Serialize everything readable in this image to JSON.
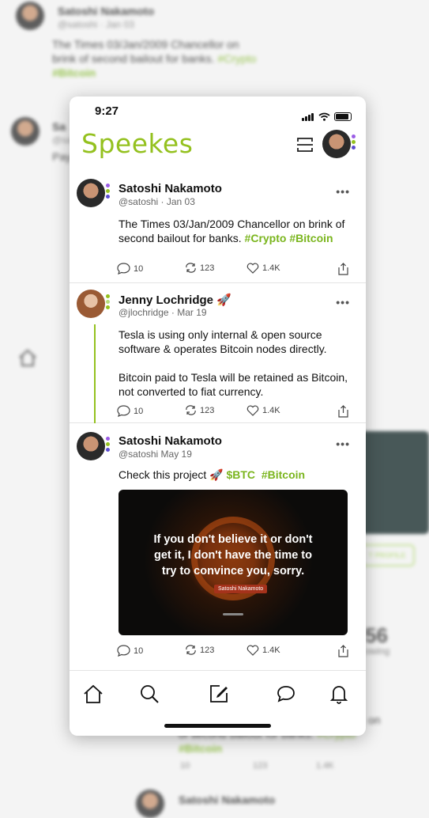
{
  "app": {
    "logo": "Speekes",
    "status_time": "9:27"
  },
  "colors": {
    "accent": "#94c11f",
    "tag": "#7ab51d",
    "thread": "#94c11f"
  },
  "header": {
    "scan_icon": "scan-icon",
    "avatar_icon": "profile-avatar"
  },
  "posts": [
    {
      "name": "Satoshi Nakamoto",
      "handle": "@satoshi · Jan 03",
      "text": "The Times 03/Jan/2009 Chancellor on brink of second bailout for banks.",
      "tags": [
        "#Crypto",
        "#Bitcoin"
      ],
      "replies": "10",
      "reposts": "123",
      "likes": "1.4K"
    },
    {
      "name": "Jenny Lochridge",
      "name_emoji": "🚀",
      "handle": "@jlochridge · Mar 19",
      "text1": "Tesla is using only internal & open source software & operates Bitcoin nodes directly.",
      "text2": "Bitcoin paid to Tesla will be retained as Bitcoin, not converted to fiat currency.",
      "replies": "10",
      "reposts": "123",
      "likes": "1.4K"
    },
    {
      "name": "Satoshi Nakamoto",
      "handle": "@satoshi May 19",
      "text": "Check this project 🚀",
      "tags": [
        "$BTC",
        "#Bitcoin"
      ],
      "media": {
        "quote_line1": "If you don't believe it or don't",
        "quote_line2": "get it, I don't have the time to",
        "quote_line3": "try to convince you, sorry.",
        "author": "Satoshi Nakamoto"
      },
      "replies": "10",
      "reposts": "123",
      "likes": "1.4K"
    }
  ],
  "more_label": "•••",
  "tabbar": [
    "home-icon",
    "search-icon",
    "compose-icon",
    "messages-icon",
    "notifications-icon"
  ],
  "background": {
    "name": "Satoshi Nakamoto",
    "handle": "@satoshi · Jan 03",
    "text1": "The Times 03/Jan/2009 Chancellor on",
    "text2": "brink of second bailout for banks.",
    "tag1": "#Crypto",
    "tag2": "#Bitcoin",
    "pill": "T PROFILE",
    "count": "56",
    "count_label": "owing",
    "short_name": "Sa",
    "short_handle": "@sa",
    "short_text": "Pay",
    "lower_text": "on",
    "lower_line": "of second bailout for banks.",
    "lower_tag": "#Crypto",
    "lower_tag2": "#Bitcoin",
    "metrics": [
      "10",
      "123",
      "1.4K"
    ]
  }
}
